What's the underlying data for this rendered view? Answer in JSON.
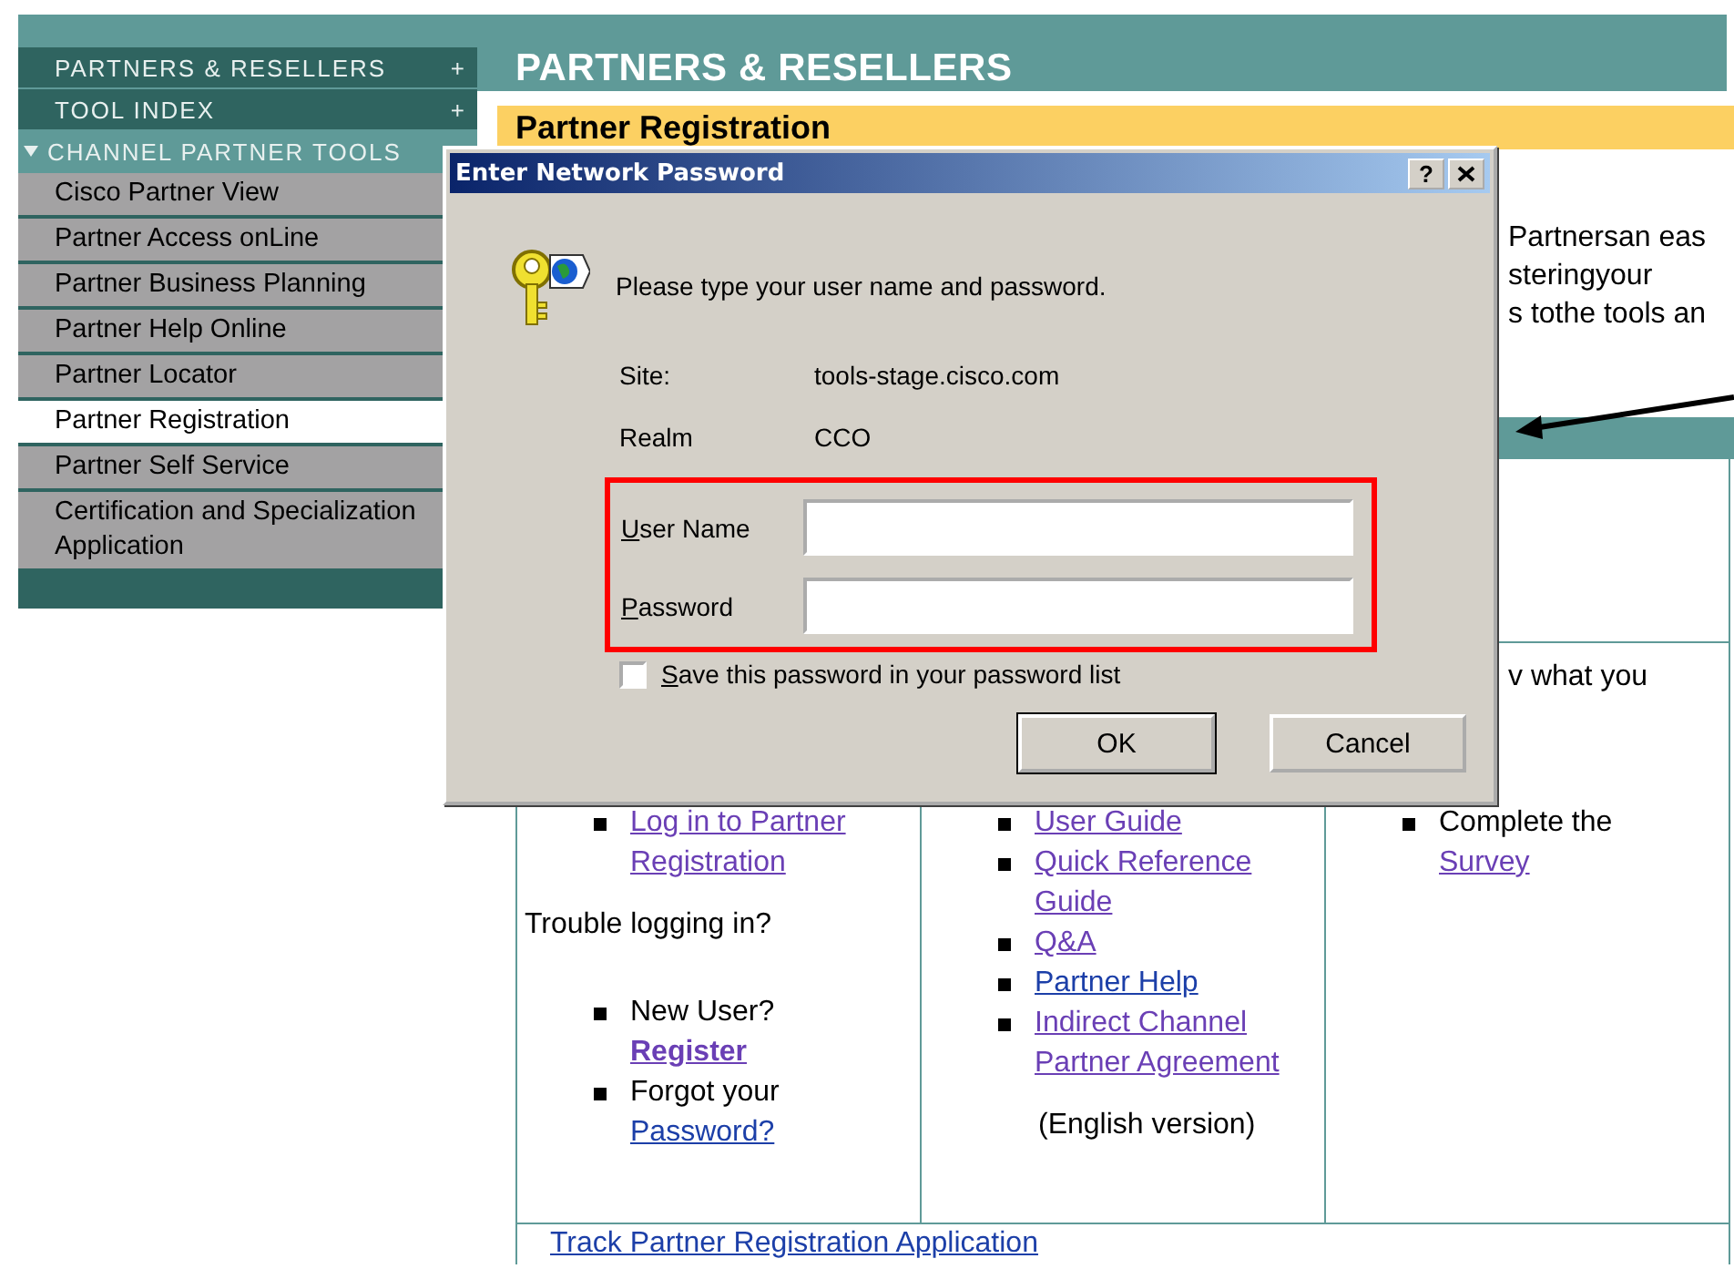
{
  "sidebar": {
    "sections": [
      {
        "label": "PARTNERS & RESELLERS",
        "toggle": "+",
        "expanded": false
      },
      {
        "label": "TOOL INDEX",
        "toggle": "+",
        "expanded": false
      },
      {
        "label": "CHANNEL PARTNER TOOLS",
        "expanded": true
      }
    ],
    "items": [
      {
        "label": "Cisco Partner View",
        "selected": false
      },
      {
        "label": "Partner Access onLine",
        "selected": false
      },
      {
        "label": "Partner Business Planning",
        "selected": false
      },
      {
        "label": "Partner Help Online",
        "selected": false
      },
      {
        "label": "Partner Locator",
        "selected": false
      },
      {
        "label": "Partner Registration",
        "selected": true
      },
      {
        "label": "Partner Self Service",
        "selected": false
      },
      {
        "label": "Certification and Specialization Application",
        "selected": false
      }
    ]
  },
  "header": {
    "title": "PARTNERS & RESELLERS",
    "page_title": "Partner Registration"
  },
  "intro_lines": [
    "Partnersan eas",
    "steringyour",
    "s tothe tools an"
  ],
  "table": {
    "columns": [
      {
        "items": [
          {
            "kind": "list",
            "entries": [
              {
                "parts": [
                  {
                    "kind": "link",
                    "text": "Log in to Partner Registration",
                    "visited": true,
                    "bold": false
                  }
                ]
              }
            ]
          },
          {
            "kind": "text",
            "text": "Trouble logging in?"
          },
          {
            "kind": "list",
            "entries": [
              {
                "parts": [
                  {
                    "kind": "text",
                    "text": "New User?"
                  },
                  {
                    "kind": "link",
                    "text": "Register",
                    "visited": true,
                    "bold": true
                  }
                ]
              },
              {
                "parts": [
                  {
                    "kind": "text",
                    "text": "Forgot your"
                  },
                  {
                    "kind": "link",
                    "text": "Password?",
                    "visited": false,
                    "bold": false
                  }
                ]
              }
            ]
          }
        ]
      },
      {
        "items": [
          {
            "kind": "list",
            "entries": [
              {
                "parts": [
                  {
                    "kind": "link",
                    "text": "User Guide",
                    "visited": true,
                    "bold": false
                  }
                ]
              },
              {
                "parts": [
                  {
                    "kind": "link",
                    "text": "Quick Reference Guide",
                    "visited": true,
                    "bold": false
                  }
                ]
              },
              {
                "parts": [
                  {
                    "kind": "link",
                    "text": "Q&A",
                    "visited": true,
                    "bold": false
                  }
                ]
              },
              {
                "parts": [
                  {
                    "kind": "link",
                    "text": "Partner Help",
                    "visited": false,
                    "bold": false
                  }
                ]
              },
              {
                "parts": [
                  {
                    "kind": "link",
                    "text": "Indirect Channel Partner Agreement",
                    "visited": true,
                    "bold": false
                  }
                ]
              }
            ]
          },
          {
            "kind": "note",
            "text": "(English version)"
          }
        ]
      },
      {
        "items": [
          {
            "kind": "top",
            "text": "v what you"
          },
          {
            "kind": "list",
            "entries": [
              {
                "parts": [
                  {
                    "kind": "text",
                    "text": "Complete the"
                  },
                  {
                    "kind": "link",
                    "text": "Survey",
                    "visited": true,
                    "bold": false
                  }
                ]
              }
            ]
          }
        ]
      }
    ],
    "footer_link": {
      "text": "Track Partner Registration Application",
      "visited": false
    }
  },
  "dialog": {
    "title": "Enter Network Password",
    "help": "?",
    "message": "Please type your user name and password.",
    "info": [
      {
        "label": "Site:",
        "value": "tools-stage.cisco.com"
      },
      {
        "label": "Realm",
        "value": "CCO"
      }
    ],
    "fields": [
      {
        "label": "User Name"
      },
      {
        "label": "Password"
      }
    ],
    "save_password": {
      "label": "Save this password in your password list",
      "checked": false
    },
    "buttons": [
      {
        "label": "OK",
        "default": true
      },
      {
        "label": "Cancel",
        "default": false
      }
    ]
  }
}
